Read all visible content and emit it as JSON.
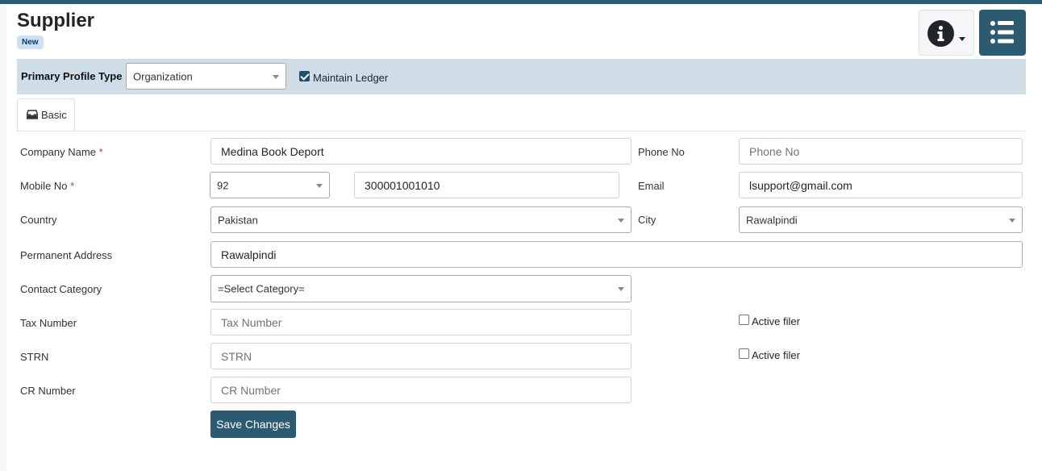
{
  "page": {
    "title": "Supplier",
    "status_badge": "New"
  },
  "profile": {
    "label": "Primary Profile Type",
    "selected": "Organization",
    "maintain_ledger_label": "Maintain Ledger",
    "maintain_ledger_checked": true
  },
  "tabs": [
    {
      "label": "Basic",
      "icon": "inbox-icon"
    }
  ],
  "form": {
    "company_name": {
      "label": "Company Name",
      "required": "*",
      "value": "Medina Book Deport"
    },
    "phone_no": {
      "label": "Phone No",
      "placeholder": "Phone No",
      "value": ""
    },
    "mobile_no": {
      "label": "Mobile No",
      "required": "*",
      "code": "92",
      "value": "300001001010"
    },
    "email": {
      "label": "Email",
      "value": "lsupport@gmail.com"
    },
    "country": {
      "label": "Country",
      "selected": "Pakistan"
    },
    "city": {
      "label": "City",
      "selected": "Rawalpindi"
    },
    "permanent_address": {
      "label": "Permanent Address",
      "value": "Rawalpindi"
    },
    "contact_category": {
      "label": "Contact Category",
      "selected": "=Select Category="
    },
    "tax_number": {
      "label": "Tax Number",
      "placeholder": "Tax Number",
      "active_filer_label": "Active filer"
    },
    "strn": {
      "label": "STRN",
      "placeholder": "STRN",
      "active_filer_label": "Active filer"
    },
    "cr_number": {
      "label": "CR Number",
      "placeholder": "CR Number"
    },
    "save_label": "Save Changes"
  },
  "colors": {
    "primary": "#2d5a73",
    "profile_bar": "#cfdde7",
    "required": "#dc3545",
    "badge_bg": "#cfe0f5"
  },
  "icons": {
    "info": "info-circle-icon",
    "menu": "list-icon",
    "dropdown": "caret-down-icon"
  }
}
